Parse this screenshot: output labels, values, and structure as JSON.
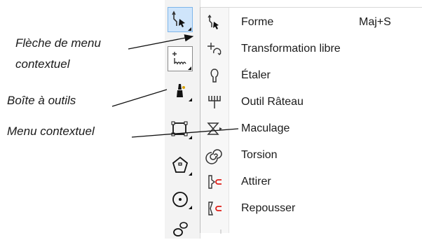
{
  "annotations": {
    "fleche_line1": "Flèche de menu",
    "fleche_line2": "contextuel",
    "boite": "Boîte à outils",
    "menu_contextuel": "Menu contextuel"
  },
  "menu": {
    "items": [
      {
        "label": "Forme",
        "shortcut": "Maj+S",
        "icon": "shape-tool-icon"
      },
      {
        "label": "Transformation libre",
        "shortcut": "",
        "icon": "free-transform-icon"
      },
      {
        "label": "Étaler",
        "shortcut": "",
        "icon": "smear-icon"
      },
      {
        "label": "Outil Râteau",
        "shortcut": "",
        "icon": "rake-icon"
      },
      {
        "label": "Maculage",
        "shortcut": "",
        "icon": "smudge-icon"
      },
      {
        "label": "Torsion",
        "shortcut": "",
        "icon": "twirl-icon"
      },
      {
        "label": "Attirer",
        "shortcut": "",
        "icon": "attract-icon"
      },
      {
        "label": "Repousser",
        "shortcut": "",
        "icon": "repel-icon"
      }
    ]
  },
  "toolbox": {
    "tools": [
      "shape-tool-icon",
      "curve-tool-icon",
      "smart-fill-icon",
      "rectangle-tool-icon",
      "polygon-tool-icon",
      "ellipse-tool-icon",
      "shape-flyout-icon"
    ]
  },
  "colors": {
    "active_tool_bg": "#cfe5fb",
    "accent_red": "#e0201a",
    "text": "#1b1b1b"
  }
}
